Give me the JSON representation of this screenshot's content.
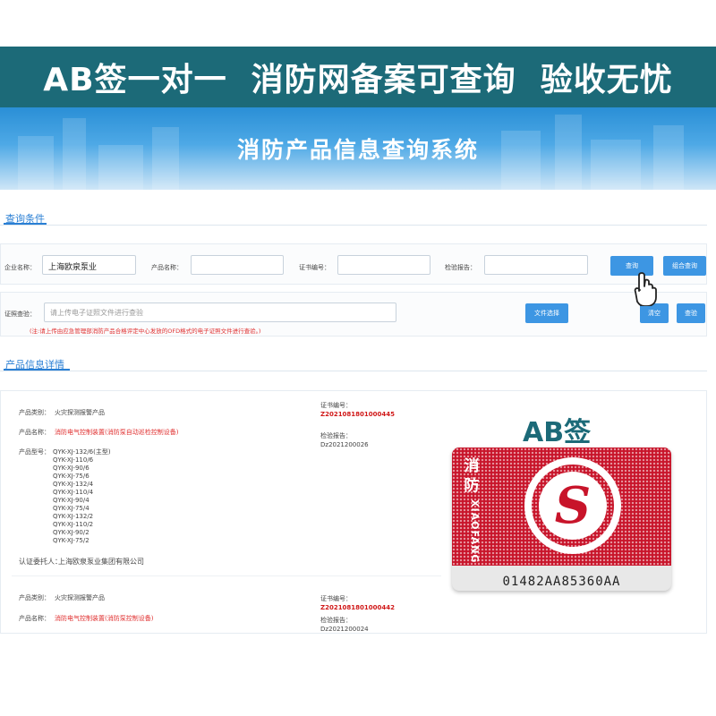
{
  "banner": {
    "text": "AB签一对一  消防网备案可查询  验收无忧"
  },
  "hero": {
    "title": "消防产品信息查询系统"
  },
  "query": {
    "section_title": "查询条件",
    "company_label": "企业名称：",
    "company_value": "上海欧泉泵业",
    "product_label": "产品名称：",
    "product_value": "",
    "cert_label": "证书编号：",
    "cert_value": "",
    "report_label": "检验报告：",
    "report_value": "",
    "search_button": "查询",
    "combo_search_button": "组合查询",
    "verify_label": "证照查验：",
    "verify_placeholder": "请上传电子证照文件进行查验",
    "file_button": "文件选择",
    "clear_button": "清空",
    "check_button": "查验",
    "note": "(注:请上传由应急管理部消防产品合格评定中心发放的OFD格式的电子证照文件进行查验。)"
  },
  "details": {
    "section_title": "产品信息详情",
    "record1": {
      "category_label": "产品类别：",
      "category_value": "火灾探测报警产品",
      "name_label": "产品名称：",
      "name_value": "消防电气控制装置(消防泵自动巡检控制设备)",
      "model_label": "产品型号：",
      "models": [
        "QYK-XJ-132/6(主型)",
        "QYK-XJ-110/6",
        "QYK-XJ-90/6",
        "QYK-XJ-75/6",
        "QYK-XJ-132/4",
        "QYK-XJ-110/4",
        "QYK-XJ-90/4",
        "QYK-XJ-75/4",
        "QYK-XJ-132/2",
        "QYK-XJ-110/2",
        "QYK-XJ-90/2",
        "QYK-XJ-75/2"
      ],
      "client_label": "认证委托人：",
      "client_value": "上海欧泉泵业集团有限公司",
      "cert_label": "证书编号：",
      "cert_value": "Z2021081801000445",
      "report_label": "检验报告：",
      "report_value": "Dz2021200026"
    },
    "record2": {
      "category_label": "产品类别：",
      "category_value": "火灾探测报警产品",
      "name_label": "产品名称：",
      "name_value": "消防电气控制装置(消防泵控制设备)",
      "cert_label": "证书编号：",
      "cert_value": "Z2021081801000442",
      "report_label": "检验报告：",
      "report_value": "Dz2021200024"
    }
  },
  "sticker": {
    "label": "AB签",
    "chinese": [
      "消",
      "防"
    ],
    "pinyin": "XIAOFANG",
    "letter": "S",
    "serial": "01482AA85360AA",
    "colors": {
      "red": "#c8142a",
      "teal": "#1c6a78"
    }
  },
  "icons": {
    "cursor": "hand-pointer-icon"
  }
}
